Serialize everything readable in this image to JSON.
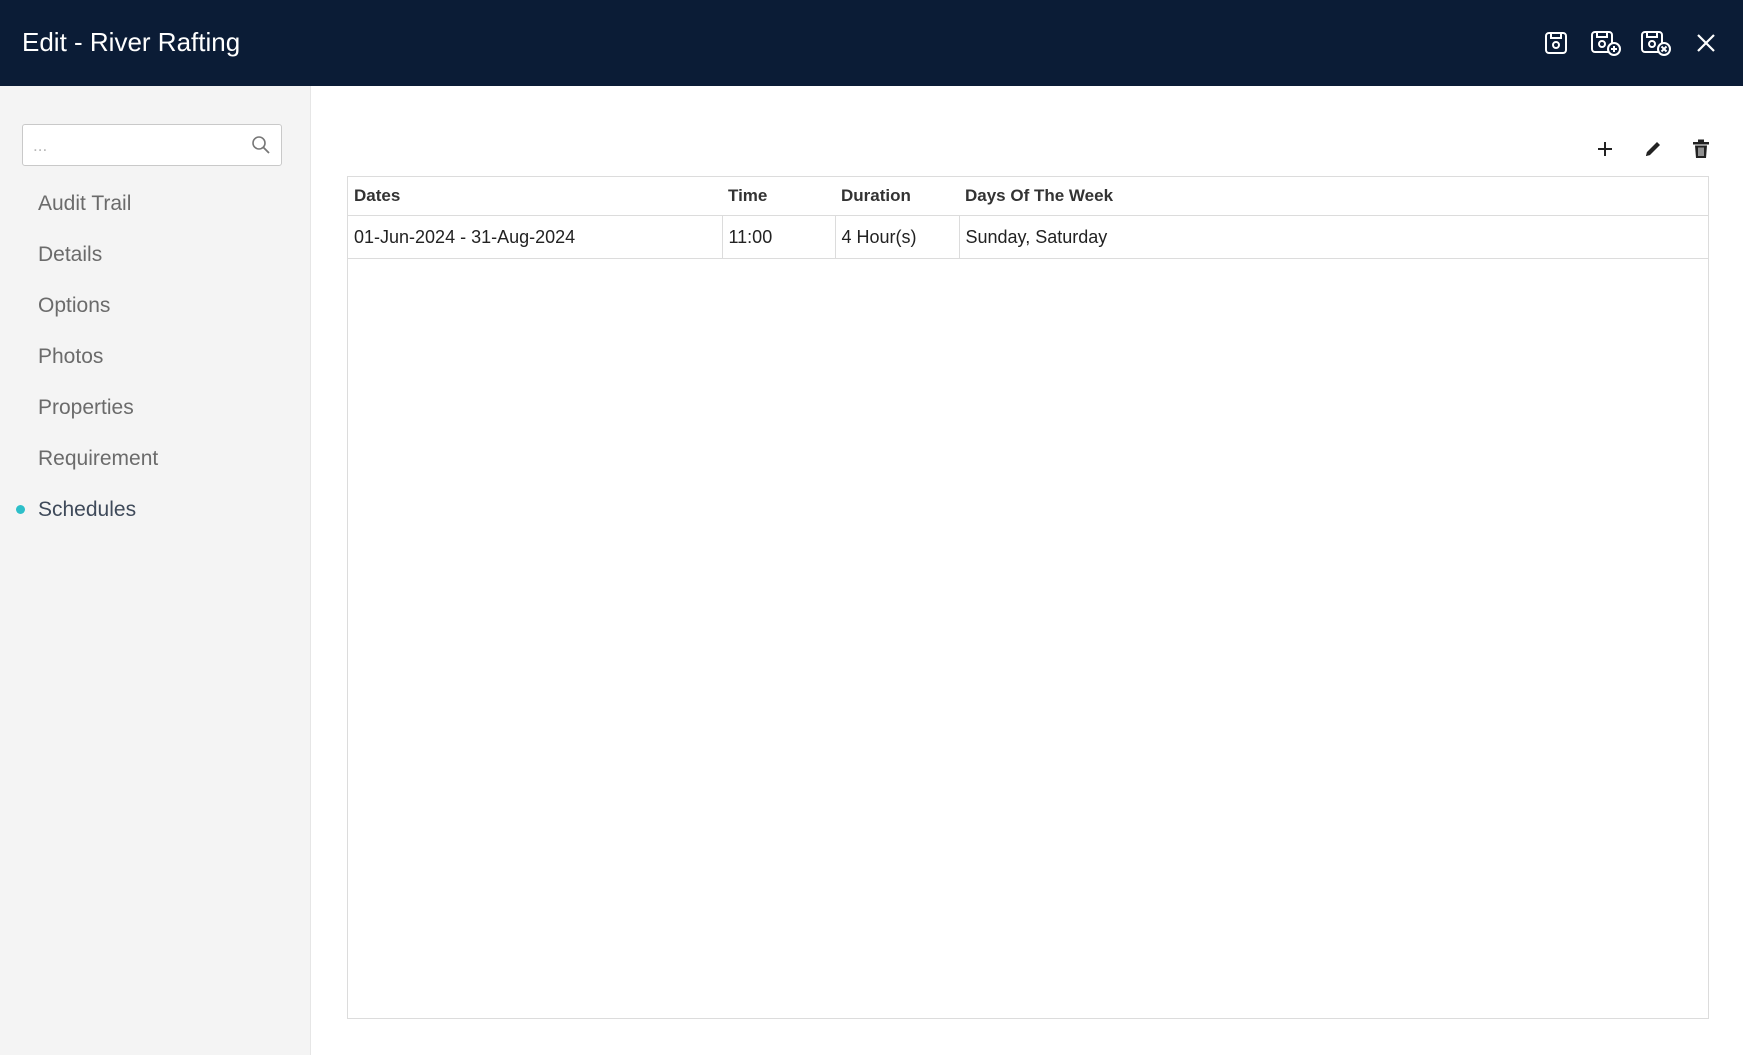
{
  "header": {
    "title": "Edit - River Rafting",
    "actions": [
      "save-icon",
      "save-and-new-icon",
      "save-and-close-icon",
      "close-icon"
    ]
  },
  "sidebar": {
    "search": {
      "placeholder": "...",
      "value": ""
    },
    "items": [
      {
        "label": "Audit Trail",
        "active": false
      },
      {
        "label": "Details",
        "active": false
      },
      {
        "label": "Options",
        "active": false
      },
      {
        "label": "Photos",
        "active": false
      },
      {
        "label": "Properties",
        "active": false
      },
      {
        "label": "Requirement",
        "active": false
      },
      {
        "label": "Schedules",
        "active": true
      }
    ]
  },
  "toolbar": {
    "actions": [
      "add-icon",
      "edit-icon",
      "delete-icon"
    ]
  },
  "table": {
    "columns": [
      "Dates",
      "Time",
      "Duration",
      "Days Of The Week"
    ],
    "rows": [
      [
        "01-Jun-2024 - 31-Aug-2024",
        "11:00",
        "4 Hour(s)",
        "Sunday, Saturday"
      ]
    ]
  },
  "colors": {
    "header_bg": "#0b1c36",
    "active_dot": "#2dbfc9",
    "sidebar_bg": "#f4f4f4"
  }
}
